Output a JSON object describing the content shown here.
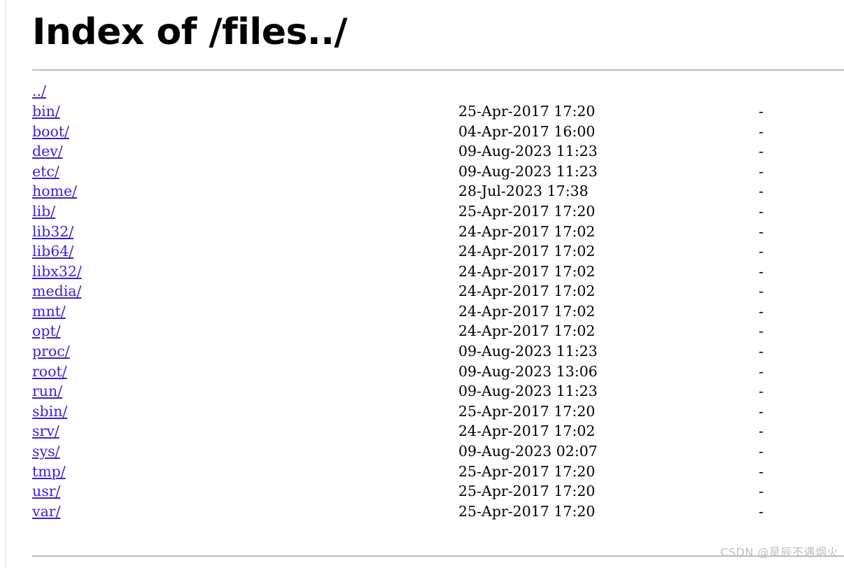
{
  "page": {
    "title": "Index of /files../",
    "watermark": "CSDN @星辰不遇烟火"
  },
  "listing": {
    "parent": {
      "name": "../",
      "date": "",
      "size": ""
    },
    "entries": [
      {
        "name": "bin/",
        "date": "25-Apr-2017 17:20",
        "size": "-"
      },
      {
        "name": "boot/",
        "date": "04-Apr-2017 16:00",
        "size": "-"
      },
      {
        "name": "dev/",
        "date": "09-Aug-2023 11:23",
        "size": "-"
      },
      {
        "name": "etc/",
        "date": "09-Aug-2023 11:23",
        "size": "-"
      },
      {
        "name": "home/",
        "date": "28-Jul-2023 17:38",
        "size": "-"
      },
      {
        "name": "lib/",
        "date": "25-Apr-2017 17:20",
        "size": "-"
      },
      {
        "name": "lib32/",
        "date": "24-Apr-2017 17:02",
        "size": "-"
      },
      {
        "name": "lib64/",
        "date": "24-Apr-2017 17:02",
        "size": "-"
      },
      {
        "name": "libx32/",
        "date": "24-Apr-2017 17:02",
        "size": "-"
      },
      {
        "name": "media/",
        "date": "24-Apr-2017 17:02",
        "size": "-"
      },
      {
        "name": "mnt/",
        "date": "24-Apr-2017 17:02",
        "size": "-"
      },
      {
        "name": "opt/",
        "date": "24-Apr-2017 17:02",
        "size": "-"
      },
      {
        "name": "proc/",
        "date": "09-Aug-2023 11:23",
        "size": "-"
      },
      {
        "name": "root/",
        "date": "09-Aug-2023 13:06",
        "size": "-"
      },
      {
        "name": "run/",
        "date": "09-Aug-2023 11:23",
        "size": "-"
      },
      {
        "name": "sbin/",
        "date": "25-Apr-2017 17:20",
        "size": "-"
      },
      {
        "name": "srv/",
        "date": "24-Apr-2017 17:02",
        "size": "-"
      },
      {
        "name": "sys/",
        "date": "09-Aug-2023 02:07",
        "size": "-"
      },
      {
        "name": "tmp/",
        "date": "25-Apr-2017 17:20",
        "size": "-"
      },
      {
        "name": "usr/",
        "date": "25-Apr-2017 17:20",
        "size": "-"
      },
      {
        "name": "var/",
        "date": "25-Apr-2017 17:20",
        "size": "-"
      }
    ]
  },
  "colors": {
    "link": "#3a23d6",
    "rule": "#bdbdbd",
    "watermark": "#bfbfbf",
    "text": "#000000"
  }
}
